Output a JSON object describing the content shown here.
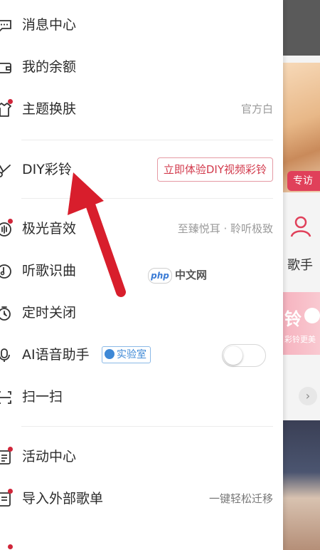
{
  "menu": {
    "messages": {
      "label": "消息中心",
      "icon": "chat-bubble-icon"
    },
    "balance": {
      "label": "我的余额",
      "icon": "wallet-icon"
    },
    "theme": {
      "label": "主题换肤",
      "value": "官方白",
      "icon": "shirt-icon",
      "badge": true
    },
    "diy": {
      "label": "DIY彩铃",
      "cta": "立即体验DIY视频彩铃",
      "icon": "scissors-icon"
    },
    "aurora": {
      "label": "极光音效",
      "value": "至臻悦耳 · 聆听极致",
      "icon": "sound-effect-icon",
      "badge": true
    },
    "recognize": {
      "label": "听歌识曲",
      "icon": "music-recognize-icon"
    },
    "timer": {
      "label": "定时关闭",
      "icon": "timer-icon"
    },
    "ai_voice": {
      "label": "AI语音助手",
      "badge_text": "实验室",
      "toggle_on": false,
      "icon": "mic-icon"
    },
    "scan": {
      "label": "扫一扫",
      "icon": "scan-icon"
    },
    "activity": {
      "label": "活动中心",
      "icon": "activity-icon",
      "badge": true
    },
    "import": {
      "label": "导入外部歌单",
      "value": "一键轻松迁移",
      "icon": "import-list-icon",
      "badge": true
    }
  },
  "background": {
    "tag": "专访",
    "singer_label": "歌手",
    "banner_text": "铃",
    "banner_sub": "彩铃更美",
    "chevron": "›"
  },
  "watermark": {
    "logo": "php",
    "text": "中文网"
  },
  "colors": {
    "accent": "#d0263a",
    "text": "#2b2b2b",
    "muted": "#9a9a9a",
    "lab": "#3d88d6"
  }
}
